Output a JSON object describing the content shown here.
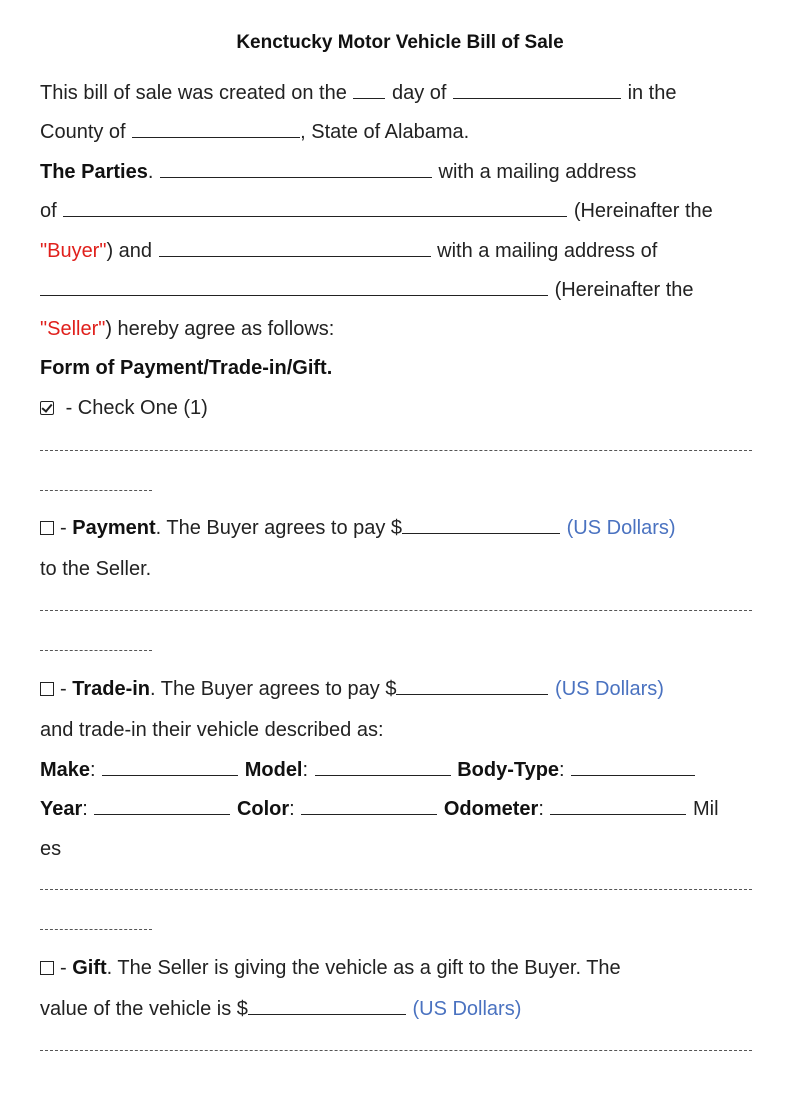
{
  "document": {
    "title": "Kenctucky Motor Vehicle Bill of Sale",
    "intro": {
      "part1": "This bill of sale was created on the",
      "part2": "day of",
      "part3": "in the",
      "part4": "County of",
      "part5": ", State of Alabama."
    },
    "parties": {
      "label": "The Parties",
      "period": ".",
      "with_mailing": "with a mailing address",
      "of": "of",
      "hereinafter1": "(Hereinafter the",
      "buyer_term": "\"Buyer\"",
      "and": ") and",
      "with_mailing_of": "with a mailing address of",
      "hereinafter2": "(Hereinafter the",
      "seller_term": "\"Seller\"",
      "agree": ") hereby agree as follows:"
    },
    "payment_form": {
      "heading": "Form of Payment/Trade-in/Gift.",
      "check_one": "- Check One (1)",
      "check_one_checked": true
    },
    "options": {
      "payment": {
        "checked": false,
        "dash": "-",
        "label": "Payment",
        "text": ". The Buyer agrees to pay $",
        "currency": "(US Dollars)",
        "continuation": "to the Seller."
      },
      "tradein": {
        "checked": false,
        "dash": "-",
        "label": "Trade-in",
        "text": ". The Buyer agrees to pay $",
        "currency": "(US Dollars)",
        "continuation": "and trade-in their vehicle described as:",
        "fields": {
          "make": "Make",
          "model": "Model",
          "body_type": "Body-Type",
          "year": "Year",
          "color": "Color",
          "odometer": "Odometer",
          "colon": ":",
          "miles_a": "Mil",
          "miles_b": "es"
        }
      },
      "gift": {
        "checked": false,
        "dash": "-",
        "label": "Gift",
        "text": ". The Seller is giving the vehicle as a gift to the Buyer. The",
        "continuation": "value of the vehicle is $",
        "currency": "(US Dollars)"
      }
    },
    "colors": {
      "term_red": "#e0201c",
      "currency_blue": "#4a72c0"
    }
  }
}
